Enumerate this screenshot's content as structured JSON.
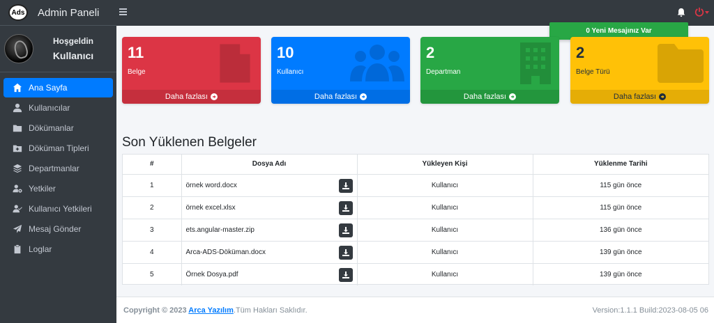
{
  "brand": {
    "logo": "Ads",
    "title": "Admin Paneli"
  },
  "user": {
    "greeting": "Hoşgeldin",
    "name": "Kullanıcı"
  },
  "sidebar": {
    "items": [
      {
        "label": "Ana Sayfa",
        "icon": "home-icon",
        "active": true
      },
      {
        "label": "Kullanıcılar",
        "icon": "user-icon"
      },
      {
        "label": "Dökümanlar",
        "icon": "folder-icon"
      },
      {
        "label": "Döküman Tipleri",
        "icon": "folder-plus-icon"
      },
      {
        "label": "Departmanlar",
        "icon": "layers-icon"
      },
      {
        "label": "Yetkiler",
        "icon": "users-cog-icon"
      },
      {
        "label": "Kullanıcı Yetkileri",
        "icon": "user-check-icon"
      },
      {
        "label": "Mesaj Gönder",
        "icon": "paper-plane-icon"
      },
      {
        "label": "Loglar",
        "icon": "clipboard-icon"
      }
    ]
  },
  "notification": {
    "text": "0 Yeni Mesajınız Var"
  },
  "boxes": [
    {
      "value": "11",
      "label": "Belge",
      "more": "Daha fazlası",
      "color": "#dc3545",
      "icon": "file-icon"
    },
    {
      "value": "10",
      "label": "Kullanıcı",
      "more": "Daha fazlası",
      "color": "#007bff",
      "icon": "users-icon"
    },
    {
      "value": "2",
      "label": "Departman",
      "more": "Daha fazlası",
      "color": "#28a745",
      "icon": "building-icon"
    },
    {
      "value": "2",
      "label": "Belge Türü",
      "more": "Daha fazlası",
      "color": "#ffc107",
      "icon": "folder-icon"
    }
  ],
  "recent": {
    "title": "Son Yüklenen Belgeler",
    "headers": [
      "#",
      "Dosya Adı",
      "Yükleyen Kişi",
      "Yüklenme Tarihi"
    ],
    "rows": [
      {
        "no": "1",
        "file": "örnek word.docx",
        "uploader": "Kullanıcı",
        "date": "115 gün önce"
      },
      {
        "no": "2",
        "file": "örnek excel.xlsx",
        "uploader": "Kullanıcı",
        "date": "115 gün önce"
      },
      {
        "no": "3",
        "file": "ets.angular-master.zip",
        "uploader": "Kullanıcı",
        "date": "136 gün önce"
      },
      {
        "no": "4",
        "file": "Arca-ADS-Döküman.docx",
        "uploader": "Kullanıcı",
        "date": "139 gün önce"
      },
      {
        "no": "5",
        "file": "Örnek Dosya.pdf",
        "uploader": "Kullanıcı",
        "date": "139 gün önce"
      }
    ]
  },
  "footer": {
    "copyright_prefix": "Copyright © 2023 ",
    "company": "Arca Yazılım",
    "rights": ".Tüm Hakları Saklıdır.",
    "version": "Version:1.1.1 Build:2023-08-05 06"
  }
}
